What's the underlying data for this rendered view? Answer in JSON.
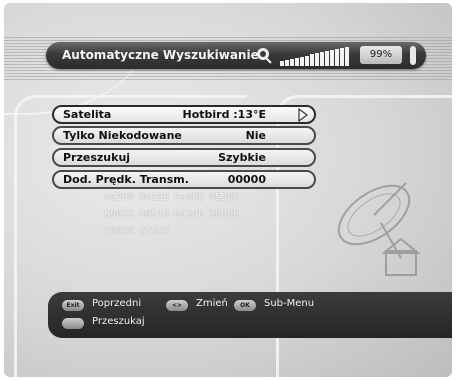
{
  "header": {
    "title": "Automatyczne Wyszukiwanie",
    "percent": "99%",
    "signal_level_percent": 99
  },
  "menu": {
    "rows": [
      {
        "label": "Satelita",
        "value": "Hotbird :13°E"
      },
      {
        "label": "Tylko Niekodowane",
        "value": "Nie"
      },
      {
        "label": "Przeszukuj",
        "value": "Szybkie"
      },
      {
        "label": "Dod. Prędk. Transm.",
        "value": "00000"
      }
    ]
  },
  "frequencies": [
    "04398",
    "06198",
    "04400",
    "05500",
    "05632",
    "06510",
    "04340",
    "28000",
    "29900",
    "27500"
  ],
  "help": {
    "exit_key": "Exit",
    "exit_label": "Poprzedni",
    "change_key": "<>",
    "change_label": "Zmień",
    "ok_key": "OK",
    "ok_label": "Sub-Menu",
    "scan_label": "Przeszukaj"
  },
  "colors": {
    "bar_dark": "#2c2c2c",
    "row_light": "#f4f4f4",
    "text_light": "#f0f0f0"
  }
}
